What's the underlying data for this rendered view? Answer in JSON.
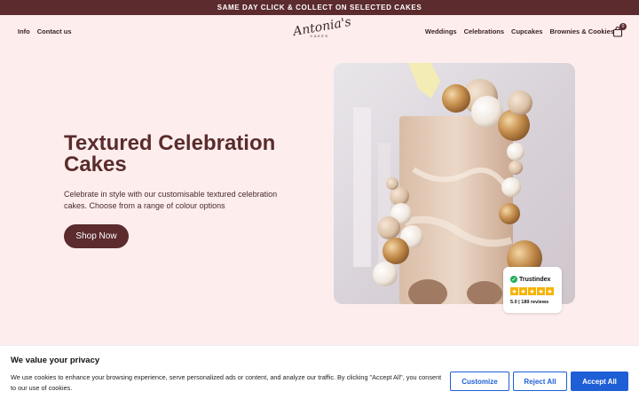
{
  "announcement": "SAME DAY CLICK & COLLECT ON SELECTED CAKES",
  "nav": {
    "left": [
      "Info",
      "Contact us"
    ],
    "right": [
      "Weddings",
      "Celebrations",
      "Cupcakes",
      "Brownies & Cookies"
    ]
  },
  "logo": {
    "script": "Antonia's",
    "sub": "CAKES"
  },
  "cart": {
    "count": "0",
    "icon": "shopping-bag-icon"
  },
  "hero": {
    "title": "Textured Celebration Cakes",
    "description": "Celebrate in style with our customisable textured celebration cakes. Choose from a range of colour options",
    "cta": "Shop Now"
  },
  "trust": {
    "name": "Trustindex",
    "score": "5.0",
    "reviews": "189 reviews",
    "rating": 5
  },
  "cookie": {
    "title": "We value your privacy",
    "text": "We use cookies to enhance your browsing experience, serve personalized ads or content, and analyze our traffic. By clicking \"Accept All\", you consent to our use of cookies.",
    "customize": "Customize",
    "reject": "Reject All",
    "accept": "Accept All"
  },
  "colors": {
    "brand": "#5b2b2e",
    "background": "#fdeeed",
    "cookie_accent": "#1f5fd6",
    "trust_green": "#1fae5b",
    "star": "#f6b300"
  }
}
